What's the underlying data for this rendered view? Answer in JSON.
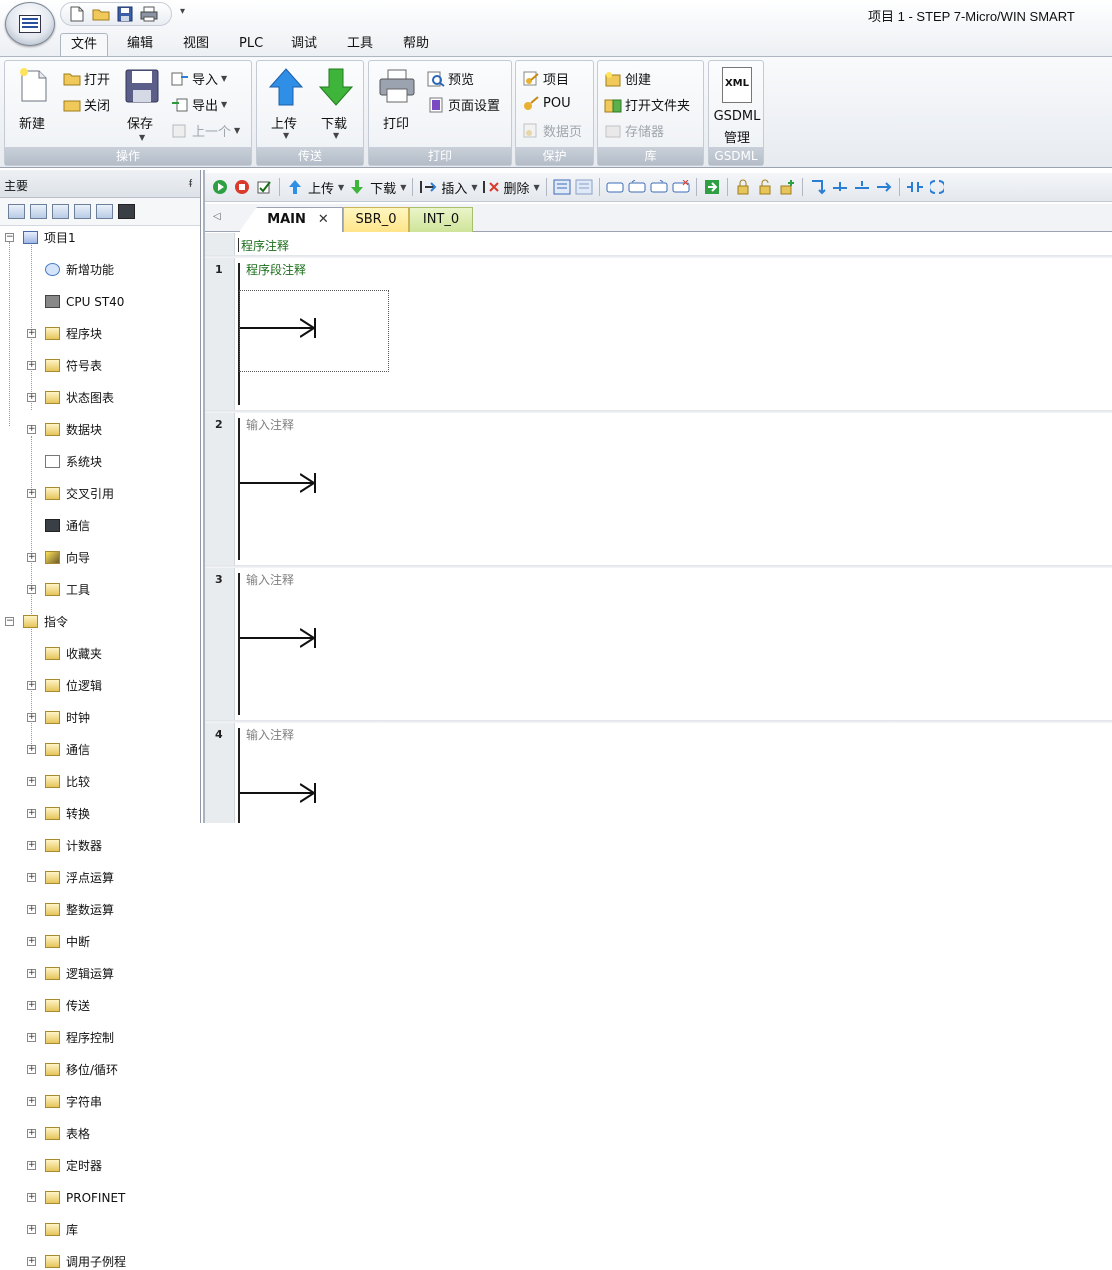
{
  "window": {
    "title": "项目 1 - STEP 7-Micro/WIN SMART"
  },
  "quick_access": {
    "items": [
      "new-icon",
      "open-icon",
      "save-icon",
      "print-icon"
    ],
    "more": "▾"
  },
  "menu": {
    "tabs": [
      {
        "label": "文件",
        "active": true
      },
      {
        "label": "编辑"
      },
      {
        "label": "视图"
      },
      {
        "label": "PLC"
      },
      {
        "label": "调试"
      },
      {
        "label": "工具"
      },
      {
        "label": "帮助"
      }
    ]
  },
  "ribbon": {
    "groups": {
      "operation": {
        "label": "操作",
        "new": "新建",
        "open": "打开",
        "close": "关闭",
        "save": "保存",
        "import": "导入",
        "export": "导出",
        "previous": "上一个"
      },
      "transfer": {
        "label": "传送",
        "upload": "上传",
        "download": "下载"
      },
      "print": {
        "label": "打印",
        "print": "打印",
        "preview": "预览",
        "page_setup": "页面设置"
      },
      "protect": {
        "label": "保护",
        "project": "项目",
        "pou": "POU",
        "data_page": "数据页"
      },
      "library": {
        "label": "库",
        "create": "创建",
        "open_folder": "打开文件夹",
        "memory": "存储器"
      },
      "gsdml": {
        "label": "GSDML",
        "manage_line1": "GSDML",
        "manage_line2": "管理",
        "xml_badge": "XML"
      }
    }
  },
  "left_panel": {
    "title": "主要",
    "pin": "ᵮ",
    "project_root": "项目1",
    "project_items": [
      "新增功能",
      "CPU ST40",
      "程序块",
      "符号表",
      "状态图表",
      "数据块",
      "系统块",
      "交叉引用",
      "通信",
      "向导",
      "工具"
    ],
    "instructions_root": "指令",
    "instruction_items": [
      "收藏夹",
      "位逻辑",
      "时钟",
      "通信",
      "比较",
      "转换",
      "计数器",
      "浮点运算",
      "整数运算",
      "中断",
      "逻辑运算",
      "传送",
      "程序控制",
      "移位/循环",
      "字符串",
      "表格",
      "定时器",
      "PROFINET",
      "库",
      "调用子例程"
    ]
  },
  "editor_toolbar": {
    "upload": "上传",
    "download": "下载",
    "insert": "插入",
    "delete": "删除"
  },
  "program_tabs": {
    "scroll": "◁",
    "main": "MAIN",
    "close": "✕",
    "sbr": "SBR_0",
    "int": "INT_0"
  },
  "ladder": {
    "program_comment": "程序注释",
    "networks": [
      {
        "number": "1",
        "comment": "程序段注释"
      },
      {
        "number": "2",
        "comment": "输入注释"
      },
      {
        "number": "3",
        "comment": "输入注释"
      },
      {
        "number": "4",
        "comment": "输入注释"
      }
    ]
  },
  "colors": {
    "accent_green": "#1a6e1a",
    "placeholder_grey": "#808080",
    "sbr_tab": "#ffe58a",
    "int_tab": "#cfe49a"
  }
}
